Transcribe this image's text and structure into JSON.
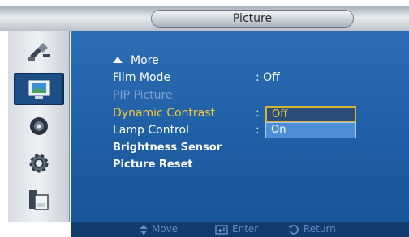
{
  "header": {
    "title": "Picture"
  },
  "sidebar": {
    "items": [
      {
        "icon": "input-icon"
      },
      {
        "icon": "picture-icon",
        "active": true
      },
      {
        "icon": "sound-icon"
      },
      {
        "icon": "setup-icon"
      },
      {
        "icon": "multi-control-icon"
      }
    ]
  },
  "menu": {
    "more_label": "More",
    "film_mode": {
      "label": "Film Mode",
      "value": ": Off"
    },
    "pip_picture": {
      "label": "PIP Picture"
    },
    "dynamic_contrast": {
      "label": "Dynamic Contrast",
      "separator": ":"
    },
    "lamp_control": {
      "label": "Lamp Control",
      "separator": ":"
    },
    "brightness_sensor": {
      "label": "Brightness Sensor"
    },
    "picture_reset": {
      "label": "Picture Reset"
    }
  },
  "dropdown": {
    "options": [
      "Off",
      "On"
    ],
    "selected": "Off"
  },
  "footer": {
    "move_label": "Move",
    "enter_label": "Enter",
    "return_label": "Return"
  },
  "colors": {
    "panel": "#1f5fa5",
    "highlight": "#f2c641",
    "disabled": "#7ea3cc",
    "footer": "#0f3b6d"
  }
}
